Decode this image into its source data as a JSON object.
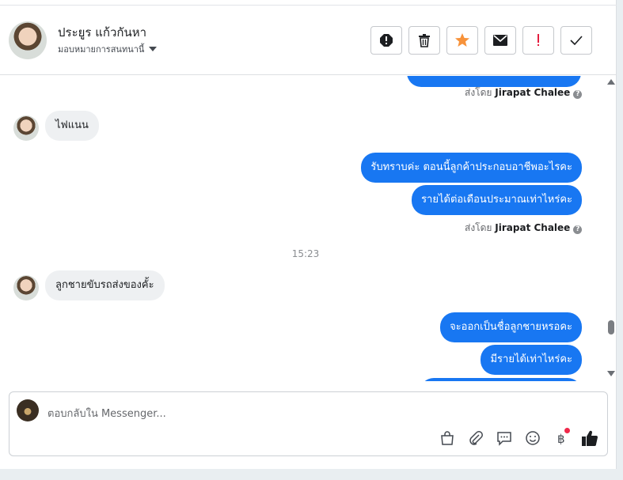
{
  "header": {
    "contact_name": "ประยูร แก้วกันหา",
    "assign_label": "มอบหมายการสนทนานี้"
  },
  "toolbar": {
    "icons": [
      "spam-icon",
      "trash-icon",
      "star-icon",
      "envelope-icon",
      "exclamation-icon",
      "check-icon"
    ],
    "colors": {
      "star": "#f7923a",
      "exclamation": "#e41e3f"
    }
  },
  "messages": {
    "sent_by_prefix": "ส่งโดย",
    "sender_name": "Jirapat Chalee",
    "incoming_1": "ไฟแนน",
    "outgoing_1": "รับทราบค่ะ ตอนนี้ลูกค้าประกอบอาชีพอะไรคะ",
    "outgoing_2": "รายได้ต่อเดือนประมาณเท่าไหร่คะ",
    "timestamp": "15:23",
    "incoming_2": "ลูกชายขับรถส่งของคั้ะ",
    "outgoing_3": "จะออกเป็นชื่อลูกชายหรอคะ",
    "outgoing_4": "มีรายได้เท่าไหร่คะ"
  },
  "composer": {
    "placeholder": "ตอบกลับใน Messenger...",
    "icons": [
      "shopping-bag-icon",
      "paperclip-icon",
      "saved-replies-icon",
      "emoji-icon",
      "payment-baht-icon",
      "thumbs-up-icon"
    ]
  },
  "theme": {
    "accent": "#1877f2",
    "incoming_bubble": "#eef0f2"
  }
}
